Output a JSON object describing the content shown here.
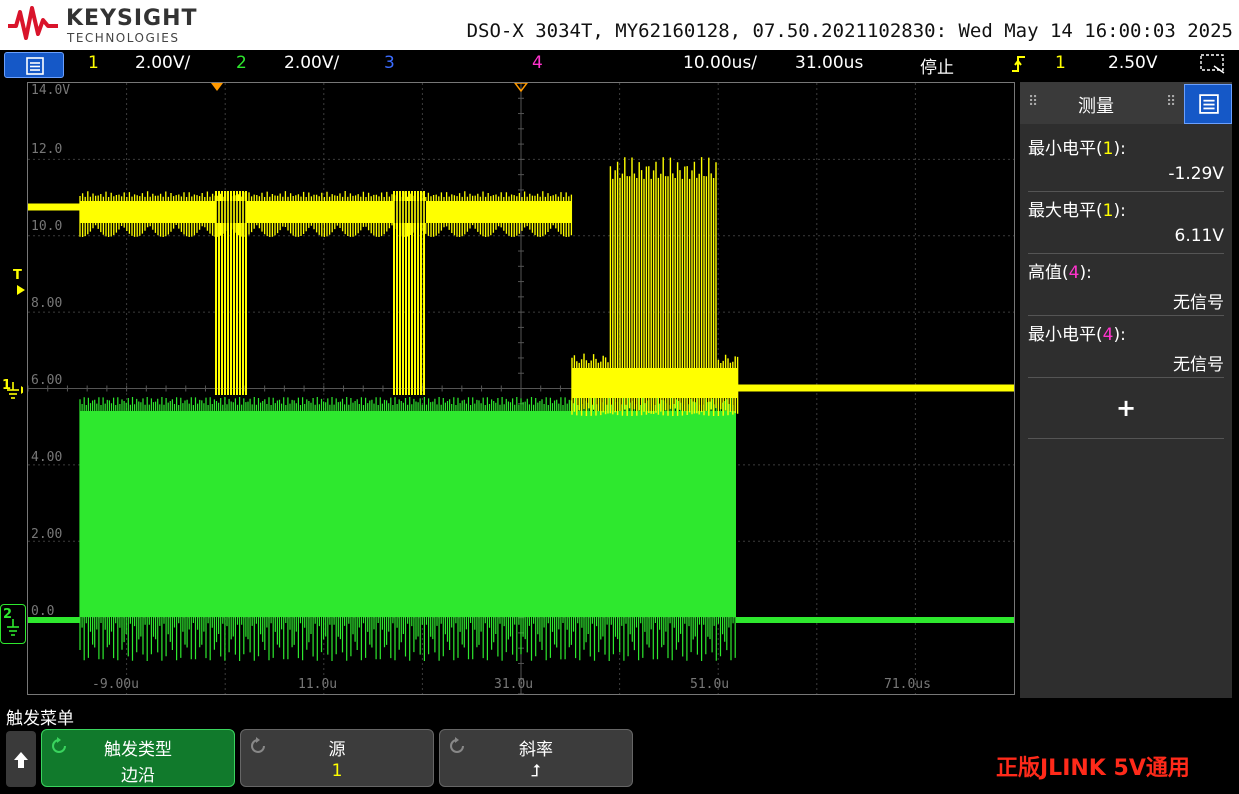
{
  "header": {
    "brand_name": "KEYSIGHT",
    "brand_sub": "TECHNOLOGIES",
    "instrument_info": "DSO-X 3034T, MY62160128, 07.50.2021102830: Wed May 14 16:00:03 2025"
  },
  "status_bar": {
    "ch1_num": "1",
    "ch1_scale": "2.00V/",
    "ch2_num": "2",
    "ch2_scale": "2.00V/",
    "ch3_num": "3",
    "ch4_num": "4",
    "time_scale": "10.00us/",
    "time_delay": "31.00us",
    "run_state": "停止",
    "trigger_icon": "rising-edge-icon",
    "trigger_source": "1",
    "trigger_level": "2.50V"
  },
  "graticule": {
    "y_labels": [
      "14.0V",
      "12.0",
      "10.0",
      "8.00",
      "6.00",
      "4.00",
      "2.00",
      "0.0"
    ],
    "x_labels": [
      "-9.00u",
      "11.0u",
      "31.0u",
      "51.0u",
      "71.0us"
    ],
    "ch1_marker": "1",
    "ch2_marker": "2",
    "trigger_marker": "T"
  },
  "measurements": {
    "title": "测量",
    "items": [
      {
        "label_pre": "最小电平(",
        "label_ch": "1",
        "label_post": "):",
        "value": "-1.29V",
        "ch_color": "#ffff00"
      },
      {
        "label_pre": "最大电平(",
        "label_ch": "1",
        "label_post": "):",
        "value": "6.11V",
        "ch_color": "#ffff00"
      },
      {
        "label_pre": "高值(",
        "label_ch": "4",
        "label_post": "):",
        "value": "无信号",
        "ch_color": "#ff33cc"
      },
      {
        "label_pre": "最小电平(",
        "label_ch": "4",
        "label_post": "):",
        "value": "无信号",
        "ch_color": "#ff33cc"
      }
    ],
    "add_label": "+"
  },
  "softkeys": {
    "menu_title": "触发菜单",
    "keys": [
      {
        "label": "触发类型",
        "value": "边沿"
      },
      {
        "label": "源",
        "value": "1"
      },
      {
        "label": "斜率",
        "value": "⮥"
      }
    ]
  },
  "promo_text": "正版JLINK 5V通用",
  "colors": {
    "ch1": "#ffff00",
    "ch2": "#2ee82e",
    "ch3": "#3b6cff",
    "ch4": "#ff33cc",
    "accent_blue": "#1558c7"
  }
}
